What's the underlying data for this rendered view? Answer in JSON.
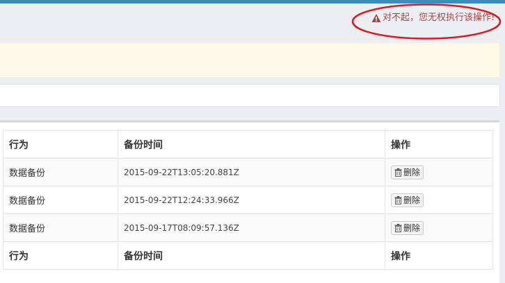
{
  "alert": {
    "text": "对不起，您无权执行该操作!",
    "color": "#a94442",
    "icon": "warning-icon"
  },
  "annotation_color": "#e0151e",
  "accent": "#3c8dbc",
  "table": {
    "columns": [
      "行为",
      "备份时间",
      "操作"
    ],
    "rows": [
      {
        "action": "数据备份",
        "time": "2015-09-22T13:05:20.881Z",
        "op_label": "删除"
      },
      {
        "action": "数据备份",
        "time": "2015-09-22T12:24:33.966Z",
        "op_label": "删除"
      },
      {
        "action": "数据备份",
        "time": "2015-09-17T08:09:57.136Z",
        "op_label": "删除"
      }
    ],
    "footer": [
      "行为",
      "备份时间",
      "操作"
    ]
  }
}
